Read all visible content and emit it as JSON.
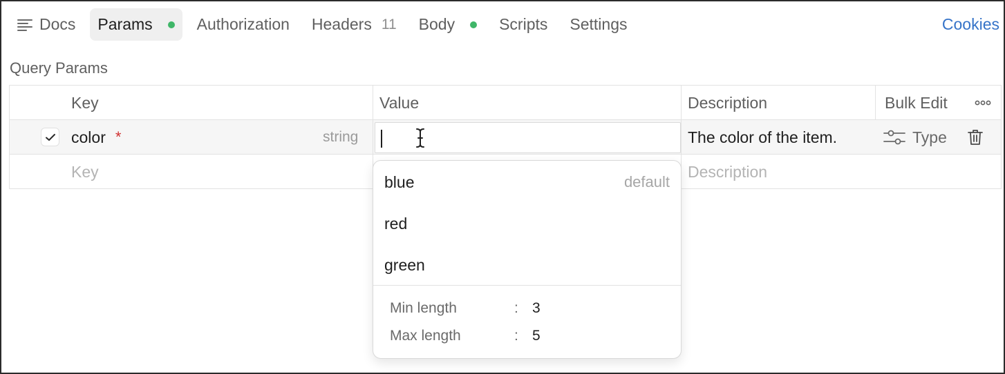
{
  "tabs": {
    "docs": "Docs",
    "params": "Params",
    "authorization": "Authorization",
    "headers": "Headers",
    "headers_count": "11",
    "body": "Body",
    "scripts": "Scripts",
    "settings": "Settings",
    "cookies": "Cookies"
  },
  "query_params": {
    "title": "Query Params",
    "columns": {
      "key": "Key",
      "value": "Value",
      "description": "Description",
      "bulk_edit": "Bulk Edit"
    },
    "rows": [
      {
        "checked": true,
        "key": "color",
        "required_mark": "*",
        "type_hint": "string",
        "value": "",
        "description": "The color of the item.",
        "type_label": "Type"
      }
    ],
    "new_row": {
      "key_placeholder": "Key",
      "description_placeholder": "Description"
    }
  },
  "value_dropdown": {
    "options": [
      {
        "label": "blue",
        "hint": "default"
      },
      {
        "label": "red",
        "hint": ""
      },
      {
        "label": "green",
        "hint": ""
      }
    ],
    "constraints": [
      {
        "label": "Min length",
        "separator": ":",
        "value": "3"
      },
      {
        "label": "Max length",
        "separator": ":",
        "value": "5"
      }
    ]
  },
  "colors": {
    "accent_link": "#3573c8",
    "status_dot": "#3fb668",
    "required": "#d03030"
  }
}
